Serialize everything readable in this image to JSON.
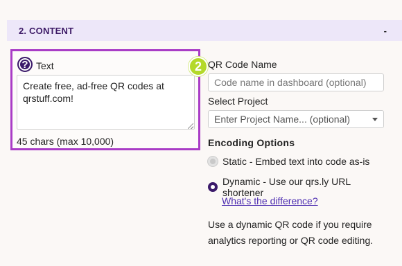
{
  "section": {
    "title": "2. CONTENT",
    "collapse_label": "-"
  },
  "text_field": {
    "label": "Text",
    "help_icon": "?",
    "value": "Create free, ad-free QR codes at qrstuff.com!",
    "char_count": "45 chars (max 10,000)"
  },
  "step_badge": "2",
  "qr_name": {
    "label": "QR Code Name",
    "placeholder": "Code name in dashboard (optional)"
  },
  "project": {
    "label": "Select Project",
    "placeholder": "Enter Project Name... (optional)"
  },
  "encoding": {
    "heading": "Encoding Options",
    "static_label": "Static - Embed text into code as-is",
    "dynamic_label": "Dynamic - Use our qrs.ly URL shortener",
    "difference_link": "What's the difference?",
    "note_line1": "Use a dynamic QR code if you require",
    "note_line2": "analytics reporting or QR code editing."
  },
  "colors": {
    "header_bg": "#ede7f9",
    "accent_purple": "#3b1a6a",
    "highlight_border": "#a93cc6",
    "badge_green": "#b4d92a"
  }
}
